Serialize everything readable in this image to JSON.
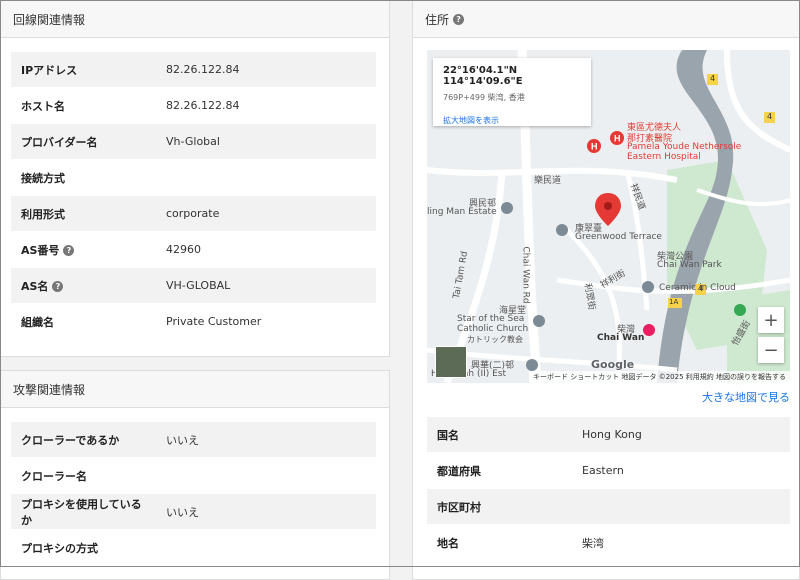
{
  "line_info": {
    "title": "回線関連情報",
    "rows": [
      {
        "label": "IPアドレス",
        "value": "82.26.122.84"
      },
      {
        "label": "ホスト名",
        "value": "82.26.122.84"
      },
      {
        "label": "プロバイダー名",
        "value": "Vh-Global"
      },
      {
        "label": "接続方式",
        "value": ""
      },
      {
        "label": "利用形式",
        "value": "corporate"
      },
      {
        "label": "AS番号",
        "value": "42960"
      },
      {
        "label": "AS名",
        "value": "VH-GLOBAL"
      },
      {
        "label": "組織名",
        "value": "Private Customer"
      }
    ]
  },
  "attack_info": {
    "title": "攻撃関連情報",
    "rows": [
      {
        "label": "クローラーであるか",
        "value": "いいえ"
      },
      {
        "label": "クローラー名",
        "value": ""
      },
      {
        "label": "プロキシを使用しているか",
        "value": "いいえ"
      },
      {
        "label": "プロキシの方式",
        "value": ""
      }
    ]
  },
  "address": {
    "title": "住所",
    "rows": [
      {
        "label": "国名",
        "value": "Hong Kong"
      },
      {
        "label": "都道府県",
        "value": "Eastern"
      },
      {
        "label": "市区町村",
        "value": ""
      },
      {
        "label": "地名",
        "value": "柴湾"
      }
    ],
    "big_map_link": "大きな地図で見る"
  },
  "map": {
    "coord": "22°16'04.1\"N 114°14'09.6\"E",
    "plus_code": "769P+499 柴湾, 香港",
    "expand_link": "拡大地図を表示",
    "zoom_in": "+",
    "zoom_out": "−",
    "google": "Google",
    "attribution": "キーボード ショートカット   地図データ ©2025   利用規約   地図の誤りを報告する",
    "labels": {
      "hospital_zh": "東區尤德夫人",
      "hospital_zh2": "那打素醫院",
      "hospital_en": "Pamela Youde Nethersole",
      "hospital_en2": "Eastern Hospital",
      "street1": "樂民道",
      "street2": "祥民道",
      "estate": "興民邨",
      "estate_en": "ling Man Estate",
      "terrace_zh": "康翠臺",
      "terrace_en": "Greenwood Terrace",
      "road1": "Chai Wan Rd",
      "road2": "Tai Tam Rd",
      "park_zh": "柴灣公園",
      "park_en": "Chai Wan Park",
      "ceramic": "Ceramic in Cloud",
      "church_zh": "海星堂",
      "church_en1": "Star of the Sea",
      "church_en2": "Catholic Church",
      "church_jp": "カトリック教会",
      "chaiwan_zh": "柴灣",
      "chaiwan_en": "Chai Wan",
      "street3": "利眾街",
      "street4": "祥利街",
      "street5": "怡盛街",
      "xingwah_zh": "興華(二)邨",
      "xingwah_en": "Hing Wah (II) Est",
      "route4": "4",
      "route1a": "1A"
    },
    "colors": {
      "water": "#aadaff",
      "park": "#c8e6c9",
      "road": "#ffffff",
      "highway": "#9aa4ad",
      "pin": "#e53935",
      "hospital": "#e53935"
    }
  }
}
